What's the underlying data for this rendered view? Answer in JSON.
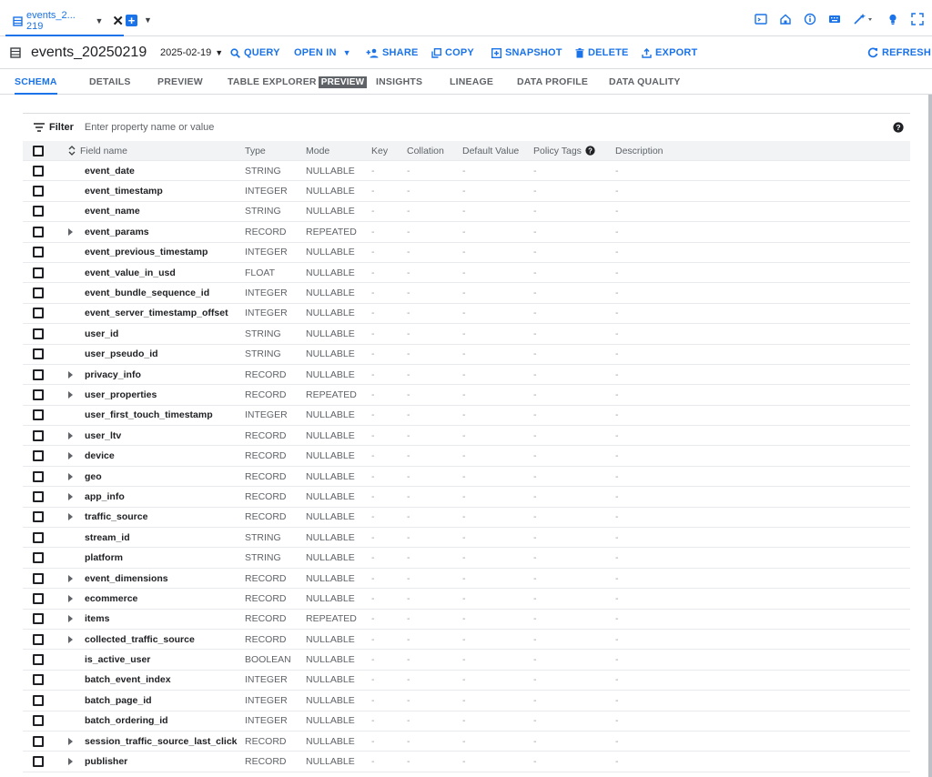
{
  "tab_strip": {
    "active_tab_label": "events_2... 219",
    "icons": [
      "terminal-icon",
      "home-icon",
      "info-icon",
      "keyboard-icon",
      "magic-wand-icon",
      "lightbulb-icon",
      "fullscreen-icon"
    ]
  },
  "toolbar": {
    "title": "events_20250219",
    "date": "2025-02-19",
    "query": "QUERY",
    "open_in": "OPEN IN",
    "share": "SHARE",
    "copy": "COPY",
    "snapshot": "SNAPSHOT",
    "delete": "DELETE",
    "export": "EXPORT",
    "refresh": "REFRESH"
  },
  "tabs": {
    "schema": "SCHEMA",
    "details": "DETAILS",
    "preview": "PREVIEW",
    "table_explorer": "TABLE EXPLORER",
    "table_explorer_badge": "PREVIEW",
    "insights": "INSIGHTS",
    "lineage": "LINEAGE",
    "data_profile": "DATA PROFILE",
    "data_quality": "DATA QUALITY"
  },
  "filter": {
    "label": "Filter",
    "placeholder": "Enter property name or value"
  },
  "columns": {
    "field_name": "Field name",
    "type": "Type",
    "mode": "Mode",
    "key": "Key",
    "collation": "Collation",
    "default_value": "Default Value",
    "policy_tags": "Policy Tags",
    "description": "Description"
  },
  "rows": [
    {
      "name": "event_date",
      "type": "STRING",
      "mode": "NULLABLE",
      "key": "-",
      "collation": "-",
      "default_value": "-",
      "policy_tags": "-",
      "description": "-",
      "expandable": false
    },
    {
      "name": "event_timestamp",
      "type": "INTEGER",
      "mode": "NULLABLE",
      "key": "-",
      "collation": "-",
      "default_value": "-",
      "policy_tags": "-",
      "description": "-",
      "expandable": false
    },
    {
      "name": "event_name",
      "type": "STRING",
      "mode": "NULLABLE",
      "key": "-",
      "collation": "-",
      "default_value": "-",
      "policy_tags": "-",
      "description": "-",
      "expandable": false
    },
    {
      "name": "event_params",
      "type": "RECORD",
      "mode": "REPEATED",
      "key": "-",
      "collation": "-",
      "default_value": "-",
      "policy_tags": "-",
      "description": "-",
      "expandable": true
    },
    {
      "name": "event_previous_timestamp",
      "type": "INTEGER",
      "mode": "NULLABLE",
      "key": "-",
      "collation": "-",
      "default_value": "-",
      "policy_tags": "-",
      "description": "-",
      "expandable": false
    },
    {
      "name": "event_value_in_usd",
      "type": "FLOAT",
      "mode": "NULLABLE",
      "key": "-",
      "collation": "-",
      "default_value": "-",
      "policy_tags": "-",
      "description": "-",
      "expandable": false
    },
    {
      "name": "event_bundle_sequence_id",
      "type": "INTEGER",
      "mode": "NULLABLE",
      "key": "-",
      "collation": "-",
      "default_value": "-",
      "policy_tags": "-",
      "description": "-",
      "expandable": false
    },
    {
      "name": "event_server_timestamp_offset",
      "type": "INTEGER",
      "mode": "NULLABLE",
      "key": "-",
      "collation": "-",
      "default_value": "-",
      "policy_tags": "-",
      "description": "-",
      "expandable": false
    },
    {
      "name": "user_id",
      "type": "STRING",
      "mode": "NULLABLE",
      "key": "-",
      "collation": "-",
      "default_value": "-",
      "policy_tags": "-",
      "description": "-",
      "expandable": false
    },
    {
      "name": "user_pseudo_id",
      "type": "STRING",
      "mode": "NULLABLE",
      "key": "-",
      "collation": "-",
      "default_value": "-",
      "policy_tags": "-",
      "description": "-",
      "expandable": false
    },
    {
      "name": "privacy_info",
      "type": "RECORD",
      "mode": "NULLABLE",
      "key": "-",
      "collation": "-",
      "default_value": "-",
      "policy_tags": "-",
      "description": "-",
      "expandable": true
    },
    {
      "name": "user_properties",
      "type": "RECORD",
      "mode": "REPEATED",
      "key": "-",
      "collation": "-",
      "default_value": "-",
      "policy_tags": "-",
      "description": "-",
      "expandable": true
    },
    {
      "name": "user_first_touch_timestamp",
      "type": "INTEGER",
      "mode": "NULLABLE",
      "key": "-",
      "collation": "-",
      "default_value": "-",
      "policy_tags": "-",
      "description": "-",
      "expandable": false
    },
    {
      "name": "user_ltv",
      "type": "RECORD",
      "mode": "NULLABLE",
      "key": "-",
      "collation": "-",
      "default_value": "-",
      "policy_tags": "-",
      "description": "-",
      "expandable": true
    },
    {
      "name": "device",
      "type": "RECORD",
      "mode": "NULLABLE",
      "key": "-",
      "collation": "-",
      "default_value": "-",
      "policy_tags": "-",
      "description": "-",
      "expandable": true
    },
    {
      "name": "geo",
      "type": "RECORD",
      "mode": "NULLABLE",
      "key": "-",
      "collation": "-",
      "default_value": "-",
      "policy_tags": "-",
      "description": "-",
      "expandable": true
    },
    {
      "name": "app_info",
      "type": "RECORD",
      "mode": "NULLABLE",
      "key": "-",
      "collation": "-",
      "default_value": "-",
      "policy_tags": "-",
      "description": "-",
      "expandable": true
    },
    {
      "name": "traffic_source",
      "type": "RECORD",
      "mode": "NULLABLE",
      "key": "-",
      "collation": "-",
      "default_value": "-",
      "policy_tags": "-",
      "description": "-",
      "expandable": true
    },
    {
      "name": "stream_id",
      "type": "STRING",
      "mode": "NULLABLE",
      "key": "-",
      "collation": "-",
      "default_value": "-",
      "policy_tags": "-",
      "description": "-",
      "expandable": false
    },
    {
      "name": "platform",
      "type": "STRING",
      "mode": "NULLABLE",
      "key": "-",
      "collation": "-",
      "default_value": "-",
      "policy_tags": "-",
      "description": "-",
      "expandable": false
    },
    {
      "name": "event_dimensions",
      "type": "RECORD",
      "mode": "NULLABLE",
      "key": "-",
      "collation": "-",
      "default_value": "-",
      "policy_tags": "-",
      "description": "-",
      "expandable": true
    },
    {
      "name": "ecommerce",
      "type": "RECORD",
      "mode": "NULLABLE",
      "key": "-",
      "collation": "-",
      "default_value": "-",
      "policy_tags": "-",
      "description": "-",
      "expandable": true
    },
    {
      "name": "items",
      "type": "RECORD",
      "mode": "REPEATED",
      "key": "-",
      "collation": "-",
      "default_value": "-",
      "policy_tags": "-",
      "description": "-",
      "expandable": true
    },
    {
      "name": "collected_traffic_source",
      "type": "RECORD",
      "mode": "NULLABLE",
      "key": "-",
      "collation": "-",
      "default_value": "-",
      "policy_tags": "-",
      "description": "-",
      "expandable": true
    },
    {
      "name": "is_active_user",
      "type": "BOOLEAN",
      "mode": "NULLABLE",
      "key": "-",
      "collation": "-",
      "default_value": "-",
      "policy_tags": "-",
      "description": "-",
      "expandable": false
    },
    {
      "name": "batch_event_index",
      "type": "INTEGER",
      "mode": "NULLABLE",
      "key": "-",
      "collation": "-",
      "default_value": "-",
      "policy_tags": "-",
      "description": "-",
      "expandable": false
    },
    {
      "name": "batch_page_id",
      "type": "INTEGER",
      "mode": "NULLABLE",
      "key": "-",
      "collation": "-",
      "default_value": "-",
      "policy_tags": "-",
      "description": "-",
      "expandable": false
    },
    {
      "name": "batch_ordering_id",
      "type": "INTEGER",
      "mode": "NULLABLE",
      "key": "-",
      "collation": "-",
      "default_value": "-",
      "policy_tags": "-",
      "description": "-",
      "expandable": false
    },
    {
      "name": "session_traffic_source_last_click",
      "type": "RECORD",
      "mode": "NULLABLE",
      "key": "-",
      "collation": "-",
      "default_value": "-",
      "policy_tags": "-",
      "description": "-",
      "expandable": true
    },
    {
      "name": "publisher",
      "type": "RECORD",
      "mode": "NULLABLE",
      "key": "-",
      "collation": "-",
      "default_value": "-",
      "policy_tags": "-",
      "description": "-",
      "expandable": true
    }
  ],
  "colors": {
    "accent": "#1a73e8",
    "text": "#202124",
    "muted": "#5f6368",
    "divider": "#dadce0"
  }
}
